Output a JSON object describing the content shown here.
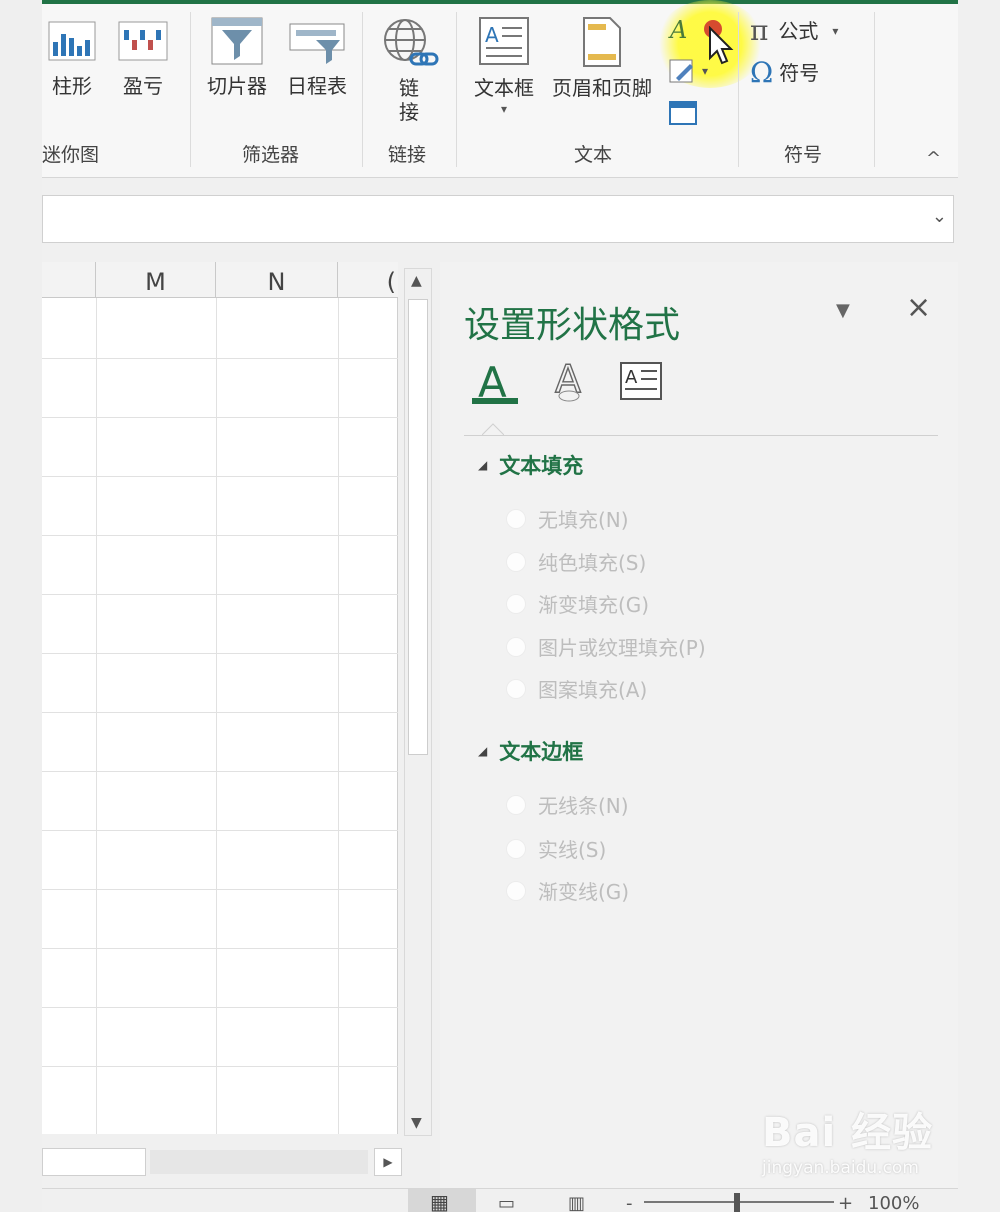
{
  "ribbon": {
    "buttons": {
      "column": "柱形",
      "winloss": "盈亏",
      "slicer": "切片器",
      "timeline": "日程表",
      "link_l1": "链",
      "link_l2": "接",
      "textbox": "文本框",
      "header_footer": "页眉和页脚",
      "equation": "公式",
      "symbol": "符号"
    },
    "groups": {
      "sparklines": "迷你图",
      "filters": "筛选器",
      "links": "链接",
      "text": "文本",
      "symbols": "符号"
    }
  },
  "sheet": {
    "columns": [
      "M",
      "N",
      "("
    ]
  },
  "pane": {
    "title": "设置形状格式",
    "sections": [
      {
        "title": "文本填充",
        "options": [
          "无填充(N)",
          "纯色填充(S)",
          "渐变填充(G)",
          "图片或纹理填充(P)",
          "图案填充(A)"
        ]
      },
      {
        "title": "文本边框",
        "options": [
          "无线条(N)",
          "实线(S)",
          "渐变线(G)"
        ]
      }
    ]
  },
  "status": {
    "zoom": "100%",
    "zoom_minus": "-",
    "zoom_plus": "+"
  },
  "watermark": {
    "brand": "Bai 经验",
    "url": "jingyan.baidu.com"
  },
  "colors": {
    "accent": "#217346",
    "highlight": "#fff83c"
  }
}
